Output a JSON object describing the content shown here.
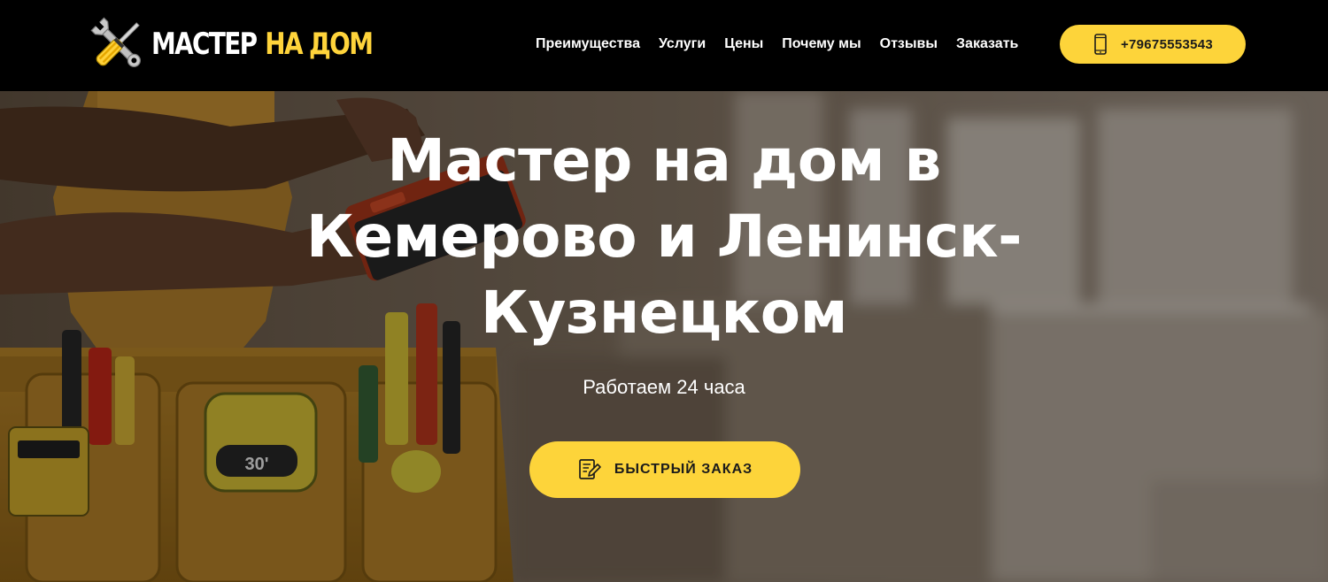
{
  "logo": {
    "word1": "МАСТЕР",
    "word2": "НА ДОМ",
    "icon": "wrench-screwdriver-icon"
  },
  "nav": {
    "items": [
      "Преимущества",
      "Услуги",
      "Цены",
      "Почему мы",
      "Отзывы",
      "Заказать"
    ]
  },
  "header": {
    "phone_label": "+79675553543",
    "phone_icon": "smartphone-icon"
  },
  "hero": {
    "title": "Мастер на дом в Кемерово и Ленинск-Кузнецком",
    "subtitle": "Работаем 24 часа",
    "cta_label": "БЫСТРЫЙ ЗАКАЗ",
    "cta_icon": "edit-document-icon",
    "tape_measure_label": "30'"
  },
  "colors": {
    "accent": "#fdd43a",
    "header_bg": "#000000",
    "text_light": "#ffffff"
  }
}
